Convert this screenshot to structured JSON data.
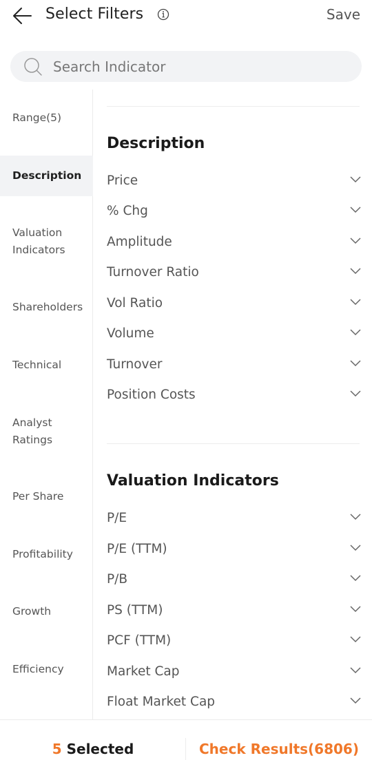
{
  "header": {
    "title": "Select Filters",
    "save_label": "Save",
    "back_icon": "arrow-left-icon",
    "info_icon": "info-circle-icon"
  },
  "search": {
    "placeholder": "Search Indicator",
    "value": "",
    "icon": "search-icon"
  },
  "sidebar": {
    "items": [
      {
        "label": "Range(5)",
        "active": false
      },
      {
        "label": "Description",
        "active": true
      },
      {
        "label": "Valuation Indicators",
        "active": false
      },
      {
        "label": "Shareholders",
        "active": false
      },
      {
        "label": "Technical",
        "active": false
      },
      {
        "label": "Analyst Ratings",
        "active": false
      },
      {
        "label": "Per Share",
        "active": false
      },
      {
        "label": "Profitability",
        "active": false
      },
      {
        "label": "Growth",
        "active": false
      },
      {
        "label": "Efficiency",
        "active": false
      }
    ]
  },
  "sections": [
    {
      "title": "Description",
      "items": [
        "Price",
        "% Chg",
        "Amplitude",
        "Turnover Ratio",
        "Vol Ratio",
        "Volume",
        "Turnover",
        "Position Costs"
      ]
    },
    {
      "title": "Valuation Indicators",
      "items": [
        "P/E",
        "P/E (TTM)",
        "P/B",
        "PS (TTM)",
        "PCF (TTM)",
        "Market Cap",
        "Float Market Cap"
      ]
    }
  ],
  "footer": {
    "selected_count": "5",
    "selected_label": "Selected",
    "check_results_label": "Check Results(6806)"
  },
  "colors": {
    "accent": "#f0782a",
    "active_bg": "#f2f3f5"
  }
}
